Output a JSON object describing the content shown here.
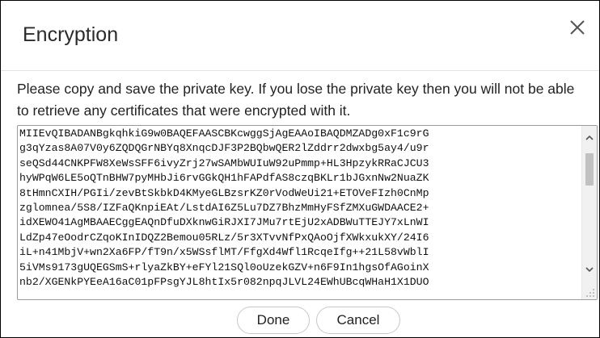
{
  "dialog": {
    "title": "Encryption",
    "close_icon": "close-icon",
    "message": "Please copy and save the private key. If you lose the private key then you will not be able to retrieve any certificates that were encrypted with it."
  },
  "private_key": {
    "lines": [
      "MIIEvQIBADANBgkqhkiG9w0BAQEFAASCBKcwggSjAgEAAoIBAQDMZADg0xF1c9rG",
      "g3qYzas8A07V0y6ZQDQGrNBYq8XnqcDJF3P2BQbwQER2lZddrr2dwxbg5ay4/u9r",
      "seQSd44CNKPFW8XeWsSFF6ivyZrj27wSAMbWUIuW92uPmmp+HL3HpzykRRaCJCU3",
      "hyWPqW6LE5oQTnBHW7pyMHbJi6rvGGkQH1hFAPdfAS8czqBKLr1bJGxnNw2NuaZK",
      "8tHmnCXIH/PGIi/zevBtSkbkD4KMyeGLBzsrKZ0rVodWeUi21+ETOVeFIzh0CnMp",
      "zglomnea/5S8/IZFaQKnpiEAt/LstdAI6Z5Lu7DZ7BhzMmHyFSfZMXuGWDAACE2+",
      "idXEWO41AgMBAAECggEAQnDfuDXknwGiRJXI7JMu7rtEjU2xADBWuTTEJY7xLnWI",
      "LdZp47eOodrCZqoKInIDQZ2Bemou05RLz/5r3XTvvNfPxQAoOjfXWkxukXY/24I6",
      "iL+n41MbjV+wn2Xa6FP/fT9n/x5WSsflMT/FfgXd4Wfl1RcqeIfg++21L58vWblI",
      "5iVMs9173gUQEGSmS+rlyaZkBY+eFYl21SQl0oUzekGZV+n6F9In1hgsOfAGoinX",
      "nb2/XGENkPYEeA16aC01pFPsgYJL8htIx5r082npqJLVL24EWhUBcqWHaH1X1DUO"
    ]
  },
  "buttons": {
    "done": "Done",
    "cancel": "Cancel"
  }
}
